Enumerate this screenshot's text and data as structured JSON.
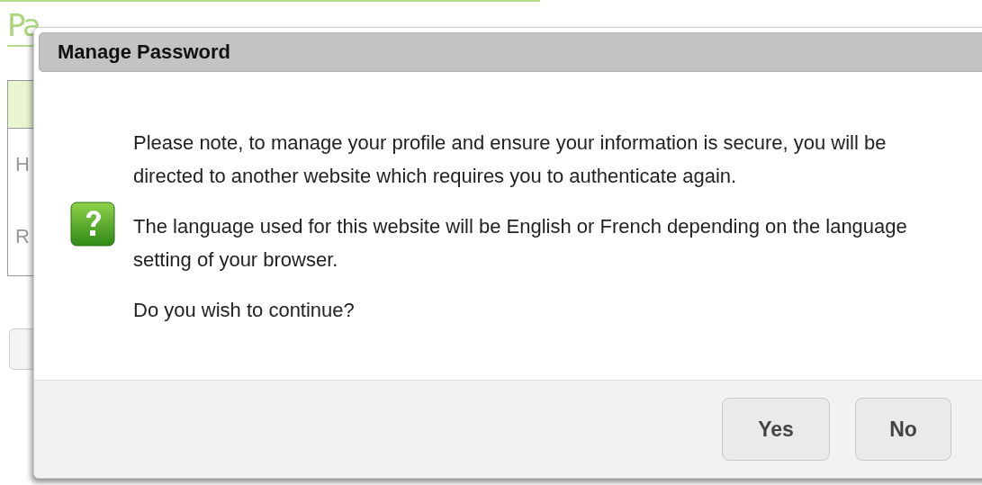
{
  "page": {
    "heading": "Pa",
    "table": {
      "rows": [
        {
          "cell": "H"
        },
        {
          "cell": "R"
        }
      ]
    }
  },
  "dialog": {
    "title": "Manage Password",
    "paragraphs": [
      "Please note, to manage your profile and ensure your information is secure, you will be directed to another website which requires you to authenticate again.",
      "The language used for this website will be English or French depending on the language setting of your browser.",
      "Do you wish to continue?"
    ],
    "buttons": [
      {
        "label": "Yes"
      },
      {
        "label": "No"
      }
    ]
  }
}
